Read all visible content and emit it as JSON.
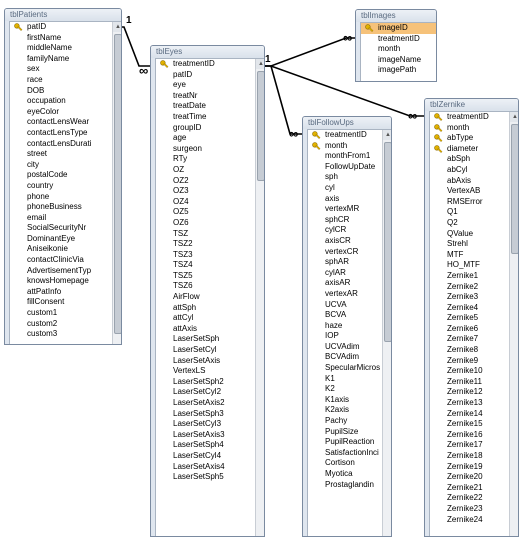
{
  "tables": {
    "patients": {
      "title": "tblPatients",
      "fields": [
        {
          "name": "patID",
          "key": true
        },
        {
          "name": "firstName"
        },
        {
          "name": "middleName"
        },
        {
          "name": "familyName"
        },
        {
          "name": "sex"
        },
        {
          "name": "race"
        },
        {
          "name": "DOB"
        },
        {
          "name": "occupation"
        },
        {
          "name": "eyeColor"
        },
        {
          "name": "contactLensWear"
        },
        {
          "name": "contactLensType"
        },
        {
          "name": "contactLensDurati"
        },
        {
          "name": "street"
        },
        {
          "name": "city"
        },
        {
          "name": "postalCode"
        },
        {
          "name": "country"
        },
        {
          "name": "phone"
        },
        {
          "name": "phoneBusiness"
        },
        {
          "name": "email"
        },
        {
          "name": "SocialSecurityNr"
        },
        {
          "name": "DominantEye"
        },
        {
          "name": "Aniseikonie"
        },
        {
          "name": "contactClinicVia"
        },
        {
          "name": "AdvertisementTyp"
        },
        {
          "name": "knowsHomepage"
        },
        {
          "name": "attPatInfo"
        },
        {
          "name": "fillConsent"
        },
        {
          "name": "custom1"
        },
        {
          "name": "custom2"
        },
        {
          "name": "custom3"
        }
      ]
    },
    "eyes": {
      "title": "tblEyes",
      "fields": [
        {
          "name": "treatmentID",
          "key": true
        },
        {
          "name": "patID"
        },
        {
          "name": "eye"
        },
        {
          "name": "treatNr"
        },
        {
          "name": "treatDate"
        },
        {
          "name": "treatTime"
        },
        {
          "name": "groupID"
        },
        {
          "name": "age"
        },
        {
          "name": "surgeon"
        },
        {
          "name": "RTy"
        },
        {
          "name": "OZ"
        },
        {
          "name": "OZ2"
        },
        {
          "name": "OZ3"
        },
        {
          "name": "OZ4"
        },
        {
          "name": "OZ5"
        },
        {
          "name": "OZ6"
        },
        {
          "name": "TSZ"
        },
        {
          "name": "TSZ2"
        },
        {
          "name": "TSZ3"
        },
        {
          "name": "TSZ4"
        },
        {
          "name": "TSZ5"
        },
        {
          "name": "TSZ6"
        },
        {
          "name": "AirFlow"
        },
        {
          "name": "attSph"
        },
        {
          "name": "attCyl"
        },
        {
          "name": "attAxis"
        },
        {
          "name": "LaserSetSph"
        },
        {
          "name": "LaserSetCyl"
        },
        {
          "name": "LaserSetAxis"
        },
        {
          "name": "VertexLS"
        },
        {
          "name": "LaserSetSph2"
        },
        {
          "name": "LaserSetCyl2"
        },
        {
          "name": "LaserSetAxis2"
        },
        {
          "name": "LaserSetSph3"
        },
        {
          "name": "LaserSetCyl3"
        },
        {
          "name": "LaserSetAxis3"
        },
        {
          "name": "LaserSetSph4"
        },
        {
          "name": "LaserSetCyl4"
        },
        {
          "name": "LaserSetAxis4"
        },
        {
          "name": "LaserSetSph5"
        }
      ]
    },
    "images": {
      "title": "tblImages",
      "fields": [
        {
          "name": "imageID",
          "key": true,
          "selected": true
        },
        {
          "name": "treatmentID"
        },
        {
          "name": "month"
        },
        {
          "name": "imageName"
        },
        {
          "name": "imagePath"
        }
      ]
    },
    "followups": {
      "title": "tblFollowUps",
      "fields": [
        {
          "name": "treatmentID",
          "key": true
        },
        {
          "name": "month",
          "key": true
        },
        {
          "name": "monthFrom1"
        },
        {
          "name": "FollowUpDate"
        },
        {
          "name": "sph"
        },
        {
          "name": "cyl"
        },
        {
          "name": "axis"
        },
        {
          "name": "vertexMR"
        },
        {
          "name": "sphCR"
        },
        {
          "name": "cylCR"
        },
        {
          "name": "axisCR"
        },
        {
          "name": "vertexCR"
        },
        {
          "name": "sphAR"
        },
        {
          "name": "cylAR"
        },
        {
          "name": "axisAR"
        },
        {
          "name": "vertexAR"
        },
        {
          "name": "UCVA"
        },
        {
          "name": "BCVA"
        },
        {
          "name": "haze"
        },
        {
          "name": "IOP"
        },
        {
          "name": "UCVAdim"
        },
        {
          "name": "BCVAdim"
        },
        {
          "name": "SpecularMicros"
        },
        {
          "name": "K1"
        },
        {
          "name": "K2"
        },
        {
          "name": "K1axis"
        },
        {
          "name": "K2axis"
        },
        {
          "name": "Pachy"
        },
        {
          "name": "PupilSize"
        },
        {
          "name": "PupilReaction"
        },
        {
          "name": "SatisfactionInci"
        },
        {
          "name": "Cortison"
        },
        {
          "name": "Myotica"
        },
        {
          "name": "Prostaglandin"
        }
      ]
    },
    "zernike": {
      "title": "tblZernike",
      "fields": [
        {
          "name": "treatmentID",
          "key": true
        },
        {
          "name": "month",
          "key": true
        },
        {
          "name": "abType",
          "key": true
        },
        {
          "name": "diameter",
          "key": true
        },
        {
          "name": "abSph"
        },
        {
          "name": "abCyl"
        },
        {
          "name": "abAxis"
        },
        {
          "name": "VertexAB"
        },
        {
          "name": "RMSError"
        },
        {
          "name": "Q1"
        },
        {
          "name": "Q2"
        },
        {
          "name": "QValue"
        },
        {
          "name": "Strehl"
        },
        {
          "name": "MTF"
        },
        {
          "name": "HO_MTF"
        },
        {
          "name": "Zernike1"
        },
        {
          "name": "Zernike2"
        },
        {
          "name": "Zernike3"
        },
        {
          "name": "Zernike4"
        },
        {
          "name": "Zernike5"
        },
        {
          "name": "Zernike6"
        },
        {
          "name": "Zernike7"
        },
        {
          "name": "Zernike8"
        },
        {
          "name": "Zernike9"
        },
        {
          "name": "Zernike10"
        },
        {
          "name": "Zernike11"
        },
        {
          "name": "Zernike12"
        },
        {
          "name": "Zernike13"
        },
        {
          "name": "Zernike14"
        },
        {
          "name": "Zernike15"
        },
        {
          "name": "Zernike16"
        },
        {
          "name": "Zernike17"
        },
        {
          "name": "Zernike18"
        },
        {
          "name": "Zernike19"
        },
        {
          "name": "Zernike20"
        },
        {
          "name": "Zernike21"
        },
        {
          "name": "Zernike22"
        },
        {
          "name": "Zernike23"
        },
        {
          "name": "Zernike24"
        }
      ]
    }
  },
  "relationships": {
    "one_label": "1",
    "many_label": "∞"
  },
  "colors": {
    "selected_field": "#f6c27a",
    "title_text": "#5a6b80",
    "key_icon": "#d8a500"
  }
}
